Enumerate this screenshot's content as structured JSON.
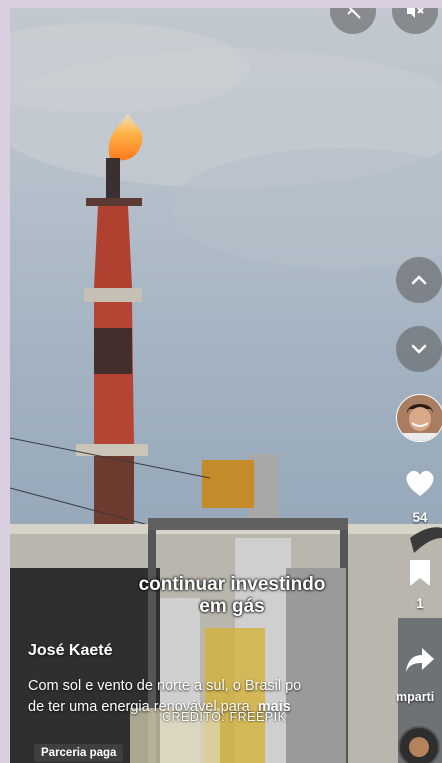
{
  "video": {
    "caption_line1": "continuar investindo",
    "caption_line2": "em gás",
    "author": "José Kaeté",
    "description_line1": "Com sol e vento de norte a sul, o Brasil po",
    "description_line2": "de ter uma energia renovável para",
    "more_label": "mais",
    "credit": "CRÉDITO: FREEPIK",
    "sponsored_badge": "Parceria paga"
  },
  "sidebar": {
    "like_count": "54",
    "save_count": "1",
    "share_label": "mparti"
  },
  "icons": {
    "top_left": "no-comments-icon",
    "top_right": "mute-icon",
    "nav_up": "chevron-up-icon",
    "nav_down": "chevron-down-icon",
    "like": "heart-icon",
    "save": "bookmark-icon",
    "share": "share-arrow-icon"
  }
}
